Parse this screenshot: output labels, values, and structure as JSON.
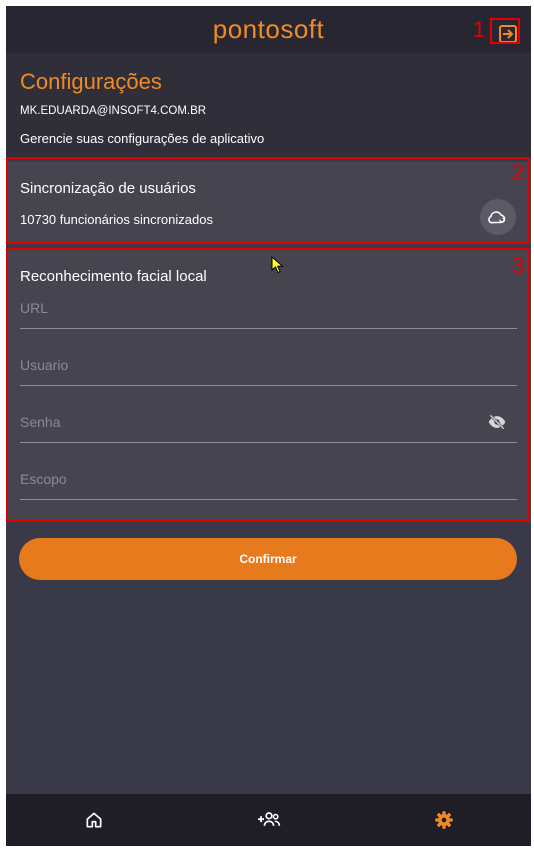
{
  "app": {
    "brand": "pontosoft"
  },
  "header": {
    "title": "Configurações",
    "email": "MK.EDUARDA@INSOFT4.COM.BR",
    "subtitle": "Gerencie suas configurações de aplicativo"
  },
  "sync": {
    "title": "Sincronização de usuários",
    "count_text": "10730 funcionários sincronizados",
    "icon": "cloud-sync-icon"
  },
  "face": {
    "title": "Reconhecimento facial local",
    "fields": [
      {
        "placeholder": "URL"
      },
      {
        "placeholder": "Usuario"
      },
      {
        "placeholder": "Senha",
        "icon": "eye-off-icon"
      },
      {
        "placeholder": "Escopo"
      }
    ]
  },
  "confirm": {
    "label": "Confirmar"
  },
  "nav": {
    "items": [
      {
        "icon": "home-icon",
        "active": false
      },
      {
        "icon": "add-users-icon",
        "active": false
      },
      {
        "icon": "gear-icon",
        "active": true
      }
    ]
  },
  "annotations": [
    "1",
    "2",
    "3"
  ],
  "colors": {
    "accent": "#e87a1e",
    "brand": "#f08b24",
    "background": "#3a3947",
    "card": "#45444f",
    "annotation": "#e00000"
  }
}
